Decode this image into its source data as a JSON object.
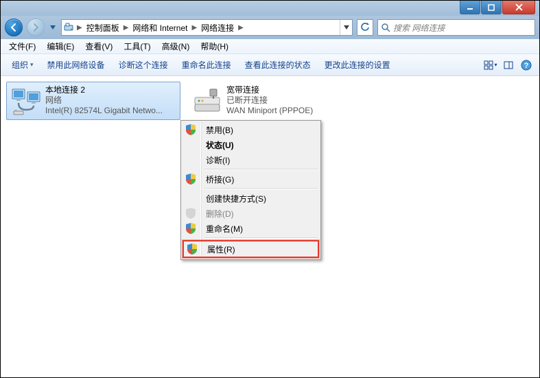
{
  "breadcrumb": {
    "items": [
      "控制面板",
      "网络和 Internet",
      "网络连接"
    ]
  },
  "search": {
    "placeholder": "搜索 网络连接"
  },
  "menus": {
    "file": "文件(F)",
    "edit": "编辑(E)",
    "view": "查看(V)",
    "tools": "工具(T)",
    "advanced": "高级(N)",
    "help": "帮助(H)"
  },
  "commands": {
    "organize": "组织",
    "disable_device": "禁用此网络设备",
    "diagnose": "诊断这个连接",
    "rename": "重命名此连接",
    "status": "查看此连接的状态",
    "change_settings": "更改此连接的设置"
  },
  "connections": [
    {
      "name": "本地连接 2",
      "status": "网络",
      "device": "Intel(R) 82574L Gigabit Netwo...",
      "selected": true
    },
    {
      "name": "宽带连接",
      "status": "已断开连接",
      "device": "WAN Miniport (PPPOE)",
      "selected": false
    }
  ],
  "context_menu": {
    "disable": "禁用(B)",
    "status": "状态(U)",
    "diagnose": "诊断(I)",
    "bridge": "桥接(G)",
    "shortcut": "创建快捷方式(S)",
    "delete": "删除(D)",
    "rename": "重命名(M)",
    "properties": "属性(R)"
  }
}
